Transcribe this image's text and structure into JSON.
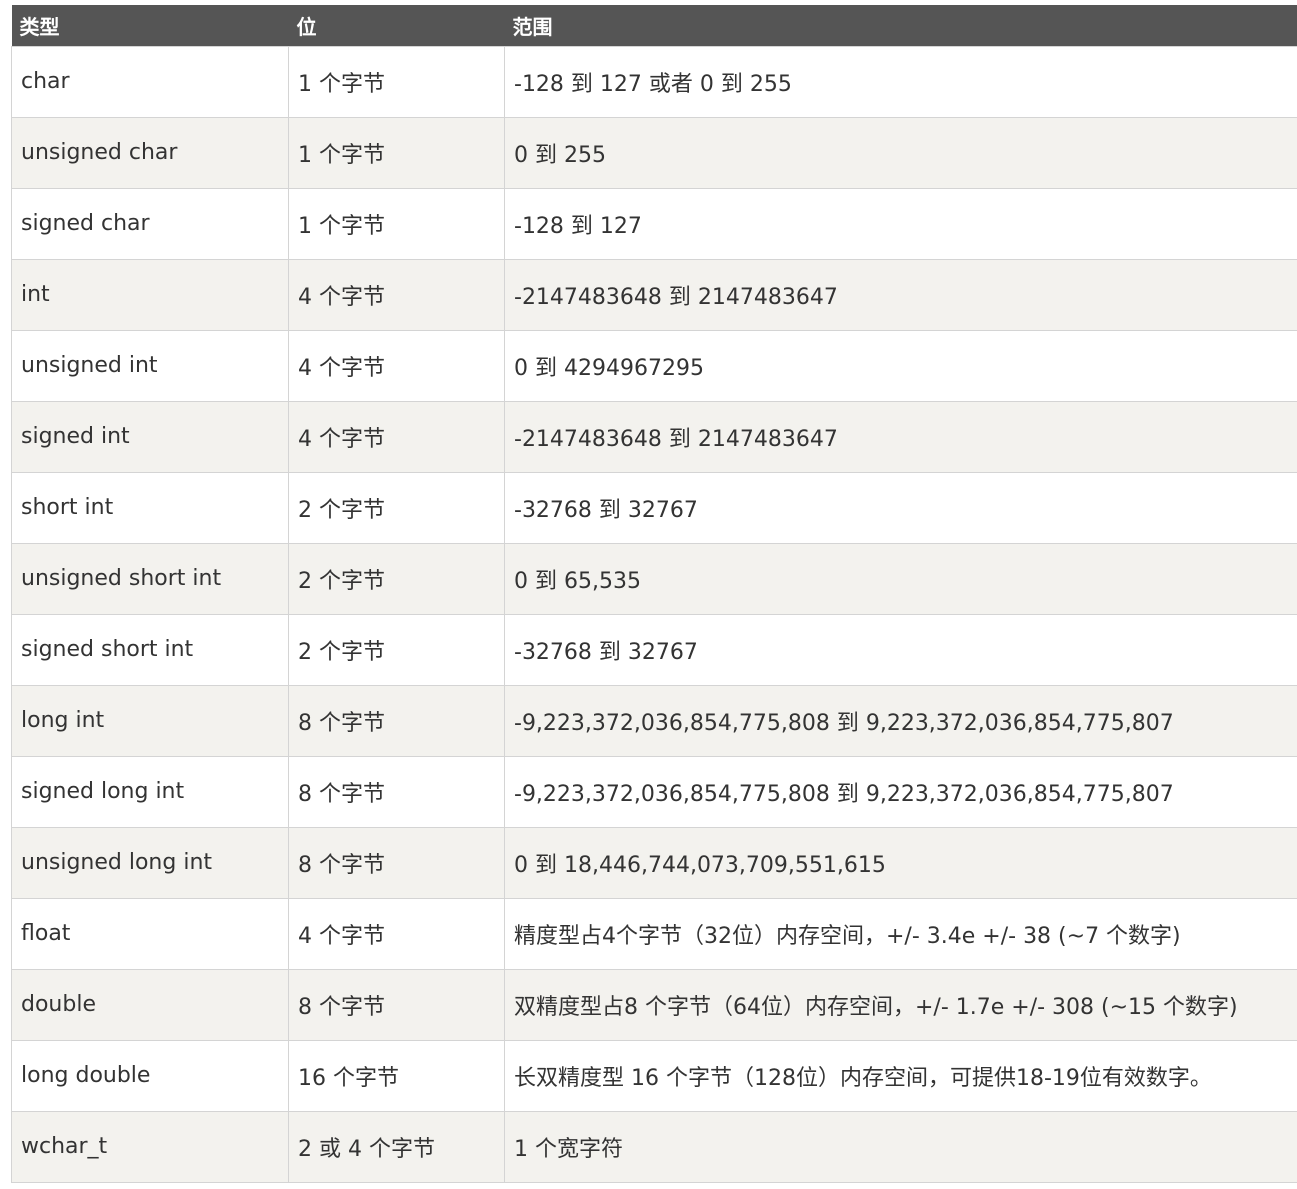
{
  "table": {
    "headers": [
      "类型",
      "位",
      "范围"
    ],
    "rows": [
      [
        "char",
        "1 个字节",
        "-128 到 127 或者 0 到 255"
      ],
      [
        "unsigned char",
        "1 个字节",
        "0 到 255"
      ],
      [
        "signed char",
        "1 个字节",
        "-128 到 127"
      ],
      [
        "int",
        "4 个字节",
        "-2147483648 到 2147483647"
      ],
      [
        "unsigned int",
        "4 个字节",
        "0 到 4294967295"
      ],
      [
        "signed int",
        "4 个字节",
        "-2147483648 到 2147483647"
      ],
      [
        "short int",
        "2 个字节",
        "-32768 到 32767"
      ],
      [
        "unsigned short int",
        "2 个字节",
        "0 到 65,535"
      ],
      [
        "signed short int",
        "2 个字节",
        "-32768 到 32767"
      ],
      [
        "long int",
        "8 个字节",
        "-9,223,372,036,854,775,808 到 9,223,372,036,854,775,807"
      ],
      [
        "signed long int",
        "8 个字节",
        "-9,223,372,036,854,775,808 到 9,223,372,036,854,775,807"
      ],
      [
        "unsigned long int",
        "8 个字节",
        "0 到 18,446,744,073,709,551,615"
      ],
      [
        "float",
        "4 个字节",
        "精度型占4个字节（32位）内存空间，+/- 3.4e +/- 38 (~7 个数字)"
      ],
      [
        "double",
        "8 个字节",
        "双精度型占8 个字节（64位）内存空间，+/- 1.7e +/- 308 (~15 个数字)"
      ],
      [
        "long double",
        "16 个字节",
        "长双精度型 16 个字节（128位）内存空间，可提供18-19位有效数字。"
      ],
      [
        "wchar_t",
        "2 或 4 个字节",
        "1 个宽字符"
      ]
    ]
  }
}
